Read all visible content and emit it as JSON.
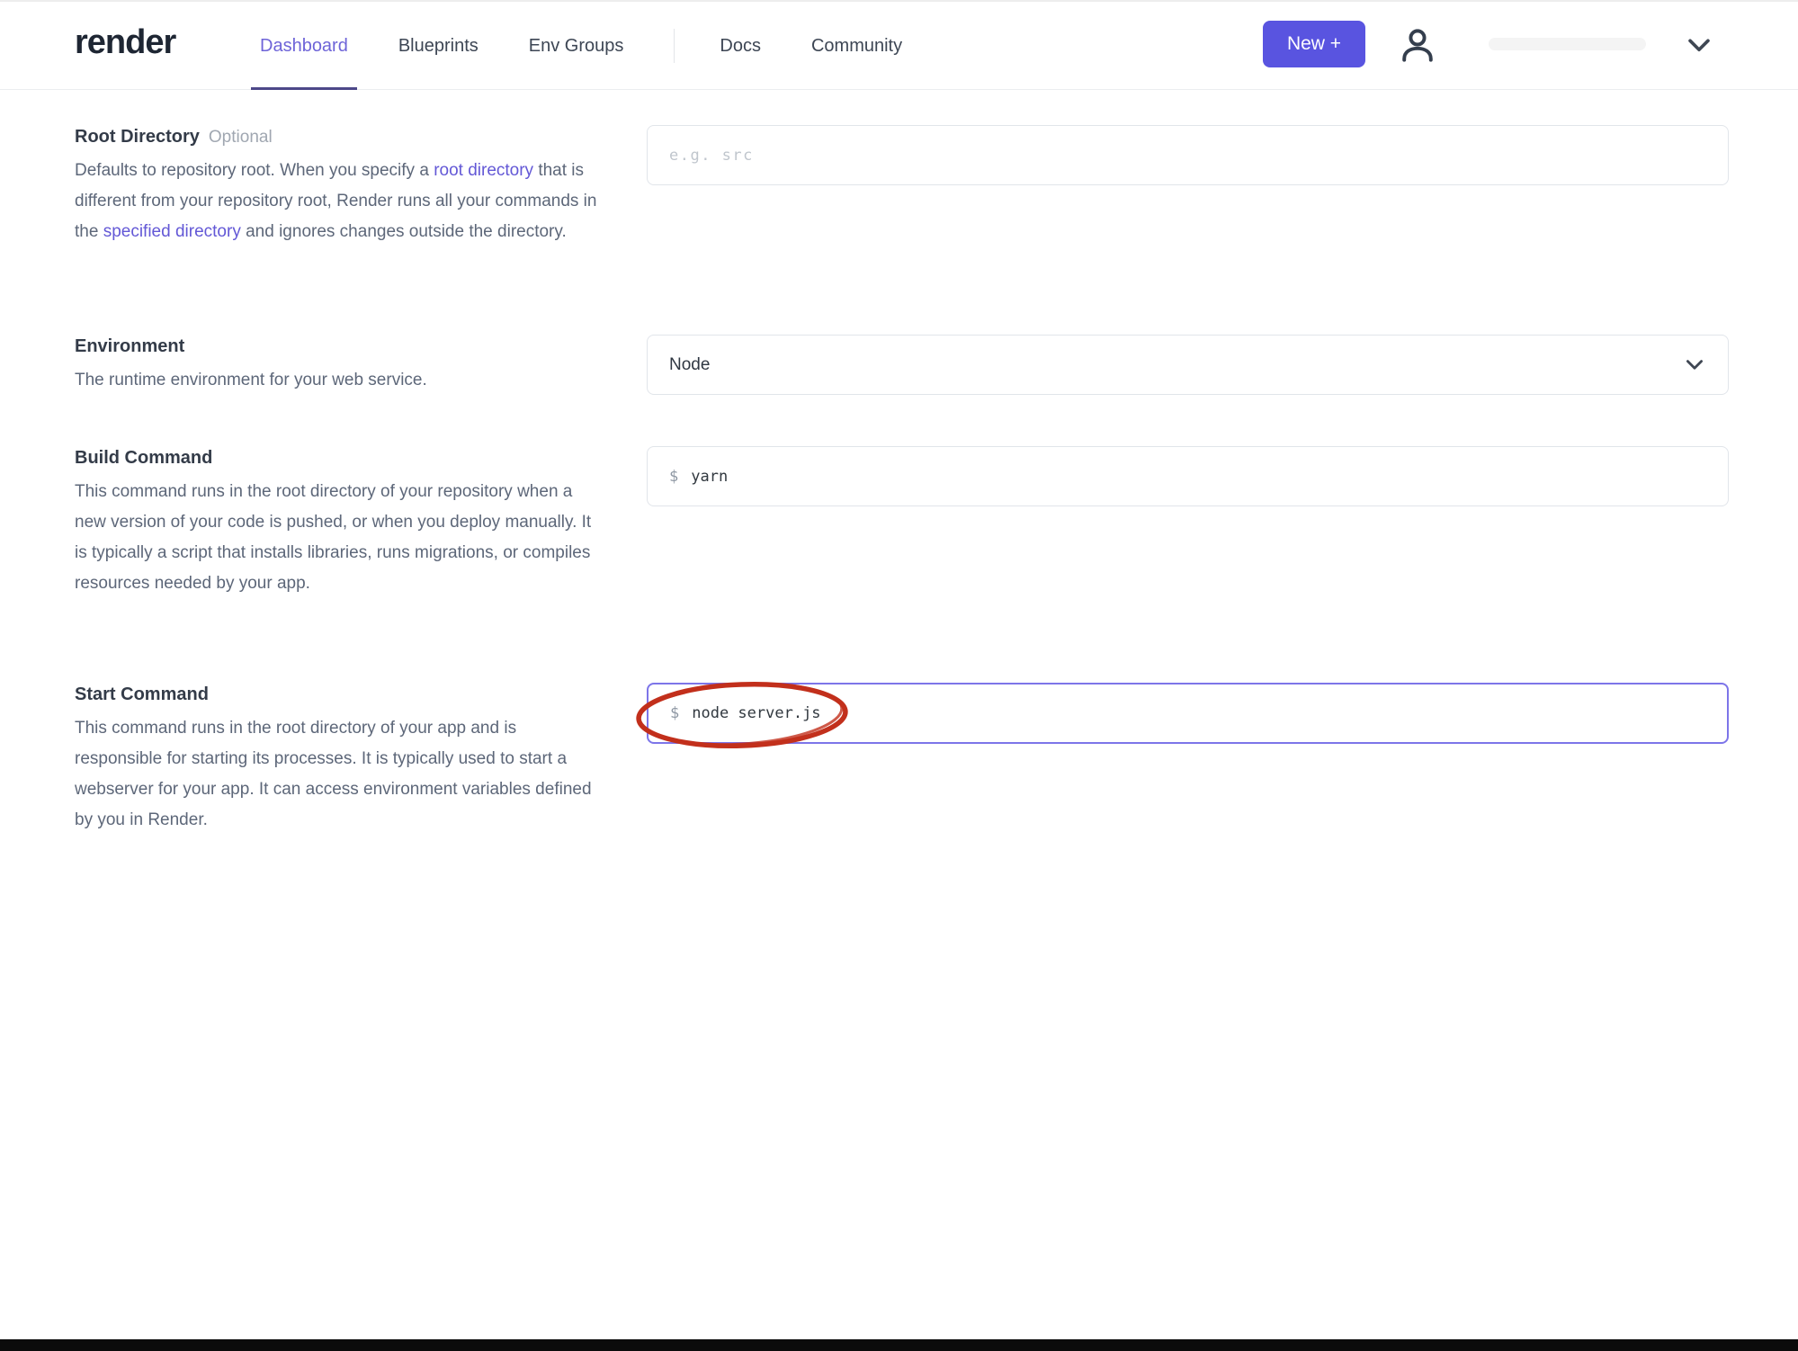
{
  "header": {
    "logo": "render",
    "nav": [
      {
        "label": "Dashboard",
        "active": true
      },
      {
        "label": "Blueprints",
        "active": false
      },
      {
        "label": "Env Groups",
        "active": false
      },
      {
        "label": "Docs",
        "active": false
      },
      {
        "label": "Community",
        "active": false
      }
    ],
    "new_button_label": "New +",
    "icons": [
      "person-icon",
      "chevron-down-icon"
    ]
  },
  "colors": {
    "accent": "#5954e0",
    "nav_active": "#6e64d8",
    "link": "#6358d6",
    "focus_border": "#7d75e9",
    "annotation_red": "#c2301c"
  },
  "form": {
    "sections": [
      {
        "label": "Root Directory",
        "badge": "Optional",
        "desc": {
          "p1": "Defaults to repository root. When you specify a ",
          "link1": "root directory",
          "p2": " that is different from your repository root, Render runs all your commands in the ",
          "link2": "specified directory",
          "p3": " and ignores changes outside the directory."
        },
        "field": {
          "type": "text",
          "placeholder": "e.g. src",
          "value": ""
        }
      },
      {
        "label": "Environment",
        "desc": {
          "p1": "The runtime environment for your web service."
        },
        "field": {
          "type": "select",
          "value": "Node"
        }
      },
      {
        "label": "Build Command",
        "desc": {
          "p1": "This command runs in the root directory of your repository when a new version of your code is pushed, or when you deploy manually. It is typically a script that installs libraries, runs migrations, or compiles resources needed by your app."
        },
        "field": {
          "type": "command",
          "prefix": "$",
          "value": "yarn"
        }
      },
      {
        "label": "Start Command",
        "desc": {
          "p1": "This command runs in the root directory of your app and is responsible for starting its processes. It is typically used to start a webserver for your app. It can access environment variables defined by you in Render."
        },
        "field": {
          "type": "command",
          "prefix": "$",
          "value": "node server.js",
          "focused": true
        }
      }
    ]
  },
  "annotation": {
    "shape": "hand-drawn-ellipse",
    "target": "start-command-value"
  }
}
